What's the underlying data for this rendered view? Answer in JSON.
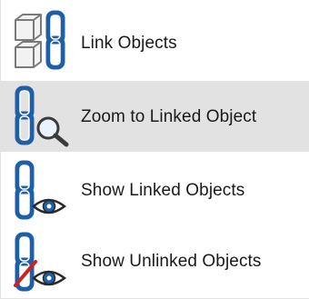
{
  "menu": {
    "items": [
      {
        "label": "Link Objects",
        "icon": "link-objects-icon",
        "highlighted": false
      },
      {
        "label": "Zoom to Linked Object",
        "icon": "zoom-linked-object-icon",
        "highlighted": true
      },
      {
        "label": "Show Linked Objects",
        "icon": "show-linked-objects-icon",
        "highlighted": false
      },
      {
        "label": "Show Unlinked Objects",
        "icon": "show-unlinked-objects-icon",
        "highlighted": false
      }
    ]
  },
  "colors": {
    "highlight": "#e2e2e2",
    "link_blue": "#1f5fa8",
    "cube_gray": "#8a8a8a",
    "strike_red": "#d02020"
  }
}
